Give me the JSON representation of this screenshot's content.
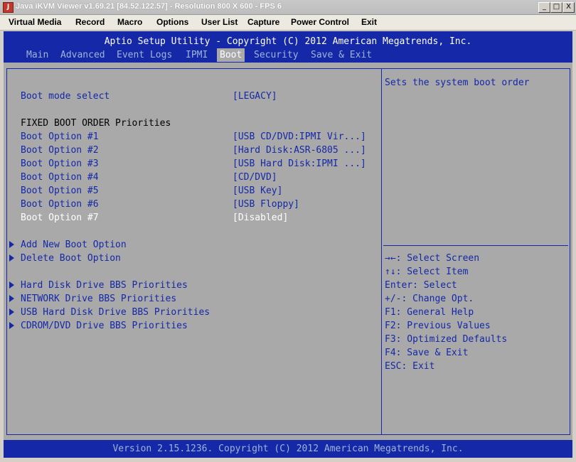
{
  "window": {
    "title": "Java iKVM Viewer v1.69.21 [84.52.122.57] - Resolution 800 X 600 - FPS 6",
    "app_icon": "java-icon",
    "buttons": [
      "_",
      "□",
      "X"
    ]
  },
  "menubar": [
    "Virtual Media",
    "Record",
    "Macro",
    "Options",
    "User List",
    "Capture",
    "Power Control",
    "Exit"
  ],
  "bios": {
    "header_title": "Aptio Setup Utility - Copyright (C) 2012 American Megatrends, Inc.",
    "tabs": [
      "Main",
      "Advanced",
      "Event Logs",
      "IPMI",
      "Boot",
      "Security",
      "Save & Exit"
    ],
    "active_tab": "Boot",
    "boot_mode": {
      "label": "Boot mode select",
      "value": "[LEGACY]"
    },
    "fixed_heading": "FIXED BOOT ORDER Priorities",
    "boot_options": [
      {
        "label": "Boot Option #1",
        "value": "[USB CD/DVD:IPMI Vir...]"
      },
      {
        "label": "Boot Option #2",
        "value": "[Hard Disk:ASR-6805 ...]"
      },
      {
        "label": "Boot Option #3",
        "value": "[USB Hard Disk:IPMI ...]"
      },
      {
        "label": "Boot Option #4",
        "value": "[CD/DVD]"
      },
      {
        "label": "Boot Option #5",
        "value": "[USB Key]"
      },
      {
        "label": "Boot Option #6",
        "value": "[USB Floppy]"
      },
      {
        "label": "Boot Option #7",
        "value": "[Disabled]"
      }
    ],
    "submenus_a": [
      "Add New Boot Option",
      "Delete Boot Option"
    ],
    "submenus_b": [
      "Hard Disk Drive BBS Priorities",
      "NETWORK Drive BBS Priorities",
      "USB Hard Disk Drive BBS Priorities",
      "CDROM/DVD Drive BBS Priorities"
    ],
    "help_text": "Sets the system boot order",
    "key_help": [
      "→←: Select Screen",
      "↑↓: Select Item",
      "Enter: Select",
      "+/-: Change Opt.",
      "F1: General Help",
      "F2: Previous Values",
      "F3: Optimized Defaults",
      "F4: Save & Exit",
      "ESC: Exit"
    ],
    "footer": "Version 2.15.1236. Copyright (C) 2012 American Megatrends, Inc.",
    "colors": {
      "background": "#a9a9a9",
      "accent_blue": "#1428a8",
      "highlight": "#ffffff"
    }
  }
}
